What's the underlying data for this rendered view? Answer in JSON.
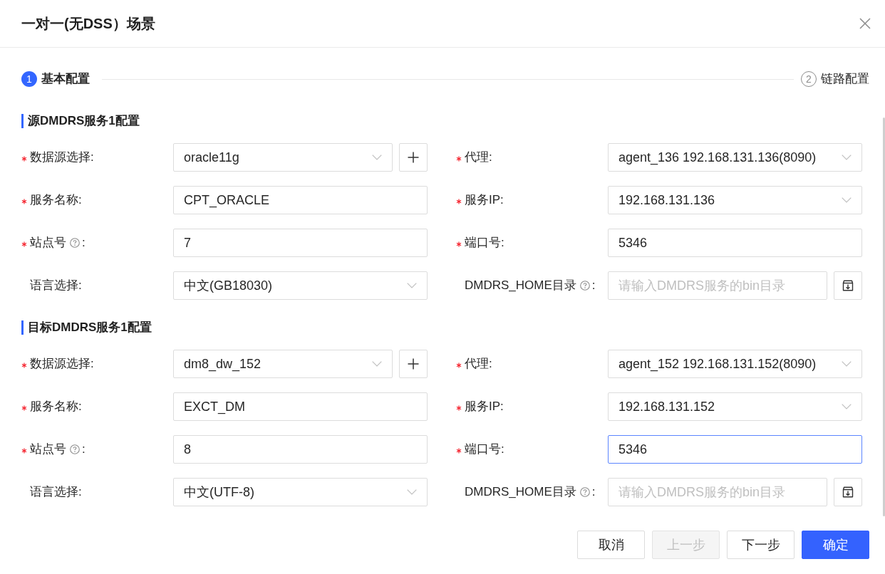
{
  "dialog": {
    "title": "一对一(无DSS）场景"
  },
  "steps": [
    {
      "number": "1",
      "label": "基本配置",
      "selected": true
    },
    {
      "number": "2",
      "label": "链路配置",
      "selected": false
    }
  ],
  "sections": [
    {
      "title": "源DMDRS服务1配置",
      "fields": [
        {
          "label": "数据源选择",
          "colon": ":",
          "required": true,
          "help": false,
          "kind": "select",
          "value": "oracle11g",
          "addon": {
            "kind": "add"
          },
          "focused": false
        },
        {
          "label": "代理",
          "colon": ":",
          "required": true,
          "help": false,
          "kind": "select",
          "value": "agent_136 192.168.131.136(8090)",
          "focused": false
        },
        {
          "label": "服务名称",
          "colon": ":",
          "required": true,
          "help": false,
          "kind": "input",
          "value": "CPT_ORACLE",
          "focused": false
        },
        {
          "label": "服务IP",
          "colon": ":",
          "required": true,
          "help": false,
          "kind": "select",
          "value": "192.168.131.136",
          "focused": false
        },
        {
          "label": "站点号",
          "colon": ":",
          "required": true,
          "help": true,
          "kind": "input",
          "value": "7",
          "focused": false
        },
        {
          "label": "端口号",
          "colon": ":",
          "required": true,
          "help": false,
          "kind": "input",
          "value": "5346",
          "focused": false
        },
        {
          "label": "语言选择",
          "colon": ":",
          "required": false,
          "help": false,
          "kind": "select",
          "value": "中文(GB18030)",
          "focused": false
        },
        {
          "label": "DMDRS_HOME目录",
          "colon": ":",
          "required": false,
          "help": true,
          "kind": "input",
          "placeholder": "请输入DMDRS服务的bin目录",
          "addon": {
            "kind": "browse"
          },
          "focused": false
        }
      ]
    },
    {
      "title": "目标DMDRS服务1配置",
      "fields": [
        {
          "label": "数据源选择",
          "colon": ":",
          "required": true,
          "help": false,
          "kind": "select",
          "value": "dm8_dw_152",
          "addon": {
            "kind": "add"
          },
          "focused": false
        },
        {
          "label": "代理",
          "colon": ":",
          "required": true,
          "help": false,
          "kind": "select",
          "value": "agent_152 192.168.131.152(8090)",
          "focused": false
        },
        {
          "label": "服务名称",
          "colon": ":",
          "required": true,
          "help": false,
          "kind": "input",
          "value": "EXCT_DM",
          "focused": false
        },
        {
          "label": "服务IP",
          "colon": ":",
          "required": true,
          "help": false,
          "kind": "select",
          "value": "192.168.131.152",
          "focused": false
        },
        {
          "label": "站点号",
          "colon": ":",
          "required": true,
          "help": true,
          "kind": "input",
          "value": "8",
          "focused": false
        },
        {
          "label": "端口号",
          "colon": ":",
          "required": true,
          "help": false,
          "kind": "input",
          "value": "5346",
          "focused": true
        },
        {
          "label": "语言选择",
          "colon": ":",
          "required": false,
          "help": false,
          "kind": "select",
          "value": "中文(UTF-8)",
          "focused": false
        },
        {
          "label": "DMDRS_HOME目录",
          "colon": ":",
          "required": false,
          "help": true,
          "kind": "input",
          "placeholder": "请输入DMDRS服务的bin目录",
          "addon": {
            "kind": "browse"
          },
          "focused": false
        }
      ]
    }
  ],
  "footer": {
    "buttons": [
      {
        "label": "取消",
        "kind": "default",
        "disabled": false
      },
      {
        "label": "上一步",
        "kind": "default",
        "disabled": true
      },
      {
        "label": "下一步",
        "kind": "default",
        "disabled": false
      },
      {
        "label": "确定",
        "kind": "primary",
        "disabled": false
      }
    ]
  }
}
